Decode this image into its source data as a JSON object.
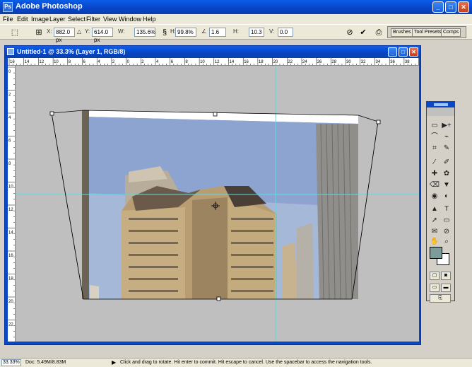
{
  "app": {
    "title": "Adobe Photoshop",
    "icon_letters": "Ps"
  },
  "window_buttons": {
    "minimize": "_",
    "maximize": "□",
    "close": "✕"
  },
  "menu": [
    "File",
    "Edit",
    "Image",
    "Layer",
    "Select",
    "Filter",
    "View",
    "Window",
    "Help"
  ],
  "options": {
    "x_label": "X:",
    "x_value": "882.0 px",
    "y_label": "Y:",
    "y_value": "614.0 px",
    "w_label": "W:",
    "w_value": "135.6%",
    "h_label": "H:",
    "h_value": "99.8%",
    "angle_label": "∠",
    "angle_value": "1.6",
    "hskew_label": "H:",
    "hskew_value": "10.3",
    "vskew_label": "V:",
    "vskew_value": "0.0",
    "cancel_icon": "⊘",
    "commit_icon": "✔",
    "palette_tabs": [
      "Brushes",
      "Tool Presets",
      "Comps"
    ]
  },
  "document": {
    "title": "Untitled-1 @ 33.3% (Layer 1, RGB/8)"
  },
  "rulers": {
    "h_labels": [
      "16",
      "14",
      "12",
      "10",
      "8",
      "6",
      "4",
      "2",
      "0",
      "2",
      "4",
      "6",
      "8",
      "10",
      "12",
      "14",
      "16",
      "18",
      "20",
      "22",
      "24",
      "26",
      "28",
      "30",
      "32",
      "34",
      "36",
      "38",
      "40"
    ],
    "v_labels": [
      "0",
      "2",
      "4",
      "6",
      "8",
      "10",
      "12",
      "14",
      "16",
      "18",
      "20",
      "22"
    ]
  },
  "status": {
    "zoom": "33.33%",
    "doc": "Doc: 5.49M/8.83M",
    "arrow": "▶",
    "hint": "Click and drag to rotate. Hit enter to commit. Hit escape to cancel. Use the spacebar to access the navigation tools."
  },
  "toolbox": {
    "tools": [
      "▭",
      "▶+",
      "⌒",
      "⌁",
      "⌗",
      "✎",
      "⁄",
      "✐",
      "✚",
      "✿",
      "⌫",
      "▼",
      "◉",
      "◐",
      "▲",
      "T",
      "➚",
      "▭",
      "✉",
      "⊘",
      "✋",
      "⌕"
    ],
    "foreground_color": "#7b9c98",
    "background_color": "#ffffff"
  }
}
